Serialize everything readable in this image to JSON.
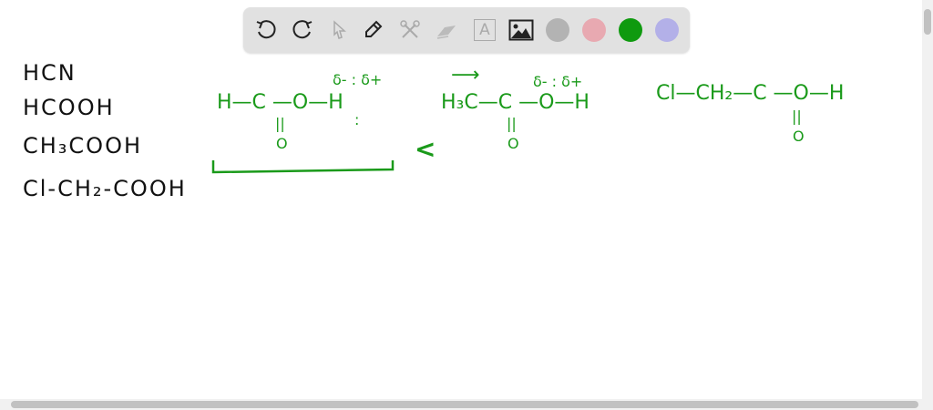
{
  "toolbar": {
    "tools": [
      "undo-icon",
      "redo-icon",
      "select-icon",
      "pen-icon",
      "tools-icon",
      "eraser-icon",
      "text-icon",
      "image-icon"
    ],
    "text_tool_glyph": "A",
    "colors": [
      "#b3b3b3",
      "#e8a9b1",
      "#0f9a0f",
      "#b3b0e8"
    ]
  },
  "canvas": {
    "list": [
      "HCN",
      "HCOOH",
      "CH₃COOH",
      "Cl-CH₂-COOH"
    ],
    "mol1": {
      "formula": "H—C —O—H",
      "dbl": "||",
      "o": "O",
      "charges": "δ- : δ+",
      "dots": ":"
    },
    "less_than": "<",
    "mol2": {
      "formula": "H₃C—C —O—H",
      "dbl": "||",
      "o": "O",
      "charges": "δ- : δ+",
      "arrow": "⟶"
    },
    "mol3": {
      "formula": "Cl—CH₂—C —O—H",
      "dbl": "||",
      "o": "O"
    }
  }
}
